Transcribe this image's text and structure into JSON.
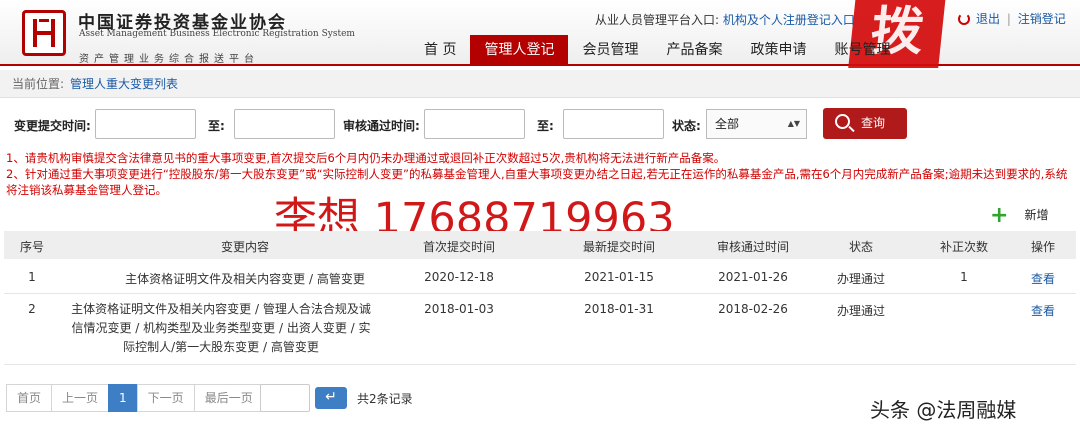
{
  "header": {
    "logo_cn": "中国证券投资基金业协会",
    "logo_en_1": "Asset Management Business Electronic Registration System",
    "logo_sub": "资产管理业务综合报送平台",
    "platform_prefix": "从业人员管理平台入口:",
    "platform_link": "机构及个人注册登记入口",
    "logout": "退出",
    "separator": "|",
    "cancel_login": "注销登记",
    "stamp_text": "拨"
  },
  "nav": {
    "items": [
      {
        "label": "首 页"
      },
      {
        "label": "管理人登记"
      },
      {
        "label": "会员管理"
      },
      {
        "label": "产品备案"
      },
      {
        "label": "政策申请"
      },
      {
        "label": "账号管理"
      }
    ]
  },
  "breadcrumb": {
    "prefix": "当前位置:",
    "current": "管理人重大变更列表"
  },
  "filter": {
    "submit_time_label": "变更提交时间:",
    "to_label_1": "至:",
    "review_time_label": "审核通过时间:",
    "to_label_2": "至:",
    "status_label": "状态:",
    "status_value": "全部",
    "status_arrow": "▲▼",
    "search_button": "查询"
  },
  "notice": {
    "line1": "1、请贵机构审慎提交含法律意见书的重大事项变更,首次提交后6个月内仍未办理通过或退回补正次数超过5次,贵机构将无法进行新产品备案。",
    "line2": "2、针对通过重大事项变更进行“控股股东/第一大股东变更”或“实际控制人变更”的私募基金管理人,自重大事项变更办结之日起,若无正在运作的私募基金产品,需在6个月内完成新产品备案;逾期未达到要求的,系统将注销该私募基金管理人登记。"
  },
  "watermark": "李想 17688719963",
  "add_button": {
    "icon": "+",
    "label": "新增"
  },
  "table": {
    "headers": [
      "序号",
      "变更内容",
      "首次提交时间",
      "最新提交时间",
      "审核通过时间",
      "状态",
      "补正次数",
      "操作"
    ],
    "rows": [
      {
        "no": "1",
        "content": "主体资格证明文件及相关内容变更 / 高管变更",
        "first_submit": "2020-12-18",
        "latest_submit": "2021-01-15",
        "review_pass": "2021-01-26",
        "status": "办理通过",
        "corrections": "1",
        "action": "查看"
      },
      {
        "no": "2",
        "content": "主体资格证明文件及相关内容变更 / 管理人合法合规及诚信情况变更 / 机构类型及业务类型变更 / 出资人变更 / 实际控制人/第一大股东变更 / 高管变更",
        "first_submit": "2018-01-03",
        "latest_submit": "2018-01-31",
        "review_pass": "2018-02-26",
        "status": "办理通过",
        "corrections": "",
        "action": "查看"
      }
    ]
  },
  "pager": {
    "first": "首页",
    "prev": "上一页",
    "current": "1",
    "next": "下一页",
    "last": "最后一页",
    "go_icon": "↵",
    "total": "共2条记录"
  },
  "source_label": "头条 @法周融媒"
}
